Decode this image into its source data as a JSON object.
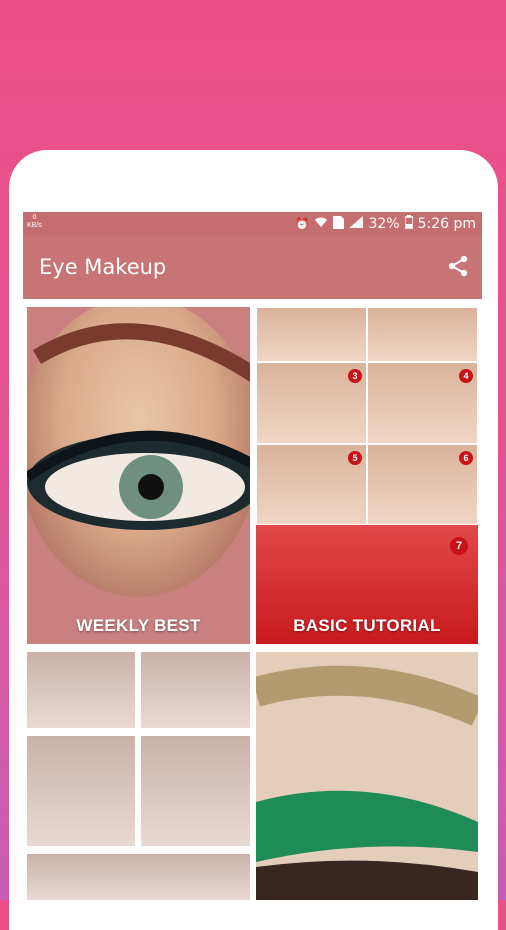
{
  "statusbar": {
    "speed_value": "0",
    "speed_unit": "KB/s",
    "battery": "32%",
    "time": "5:26 pm"
  },
  "toolbar": {
    "title": "Eye Makeup",
    "share_icon": "share-icon"
  },
  "tiles": [
    {
      "label": "WEEKLY BEST"
    },
    {
      "label": "BASIC TUTORIAL"
    }
  ],
  "tutorial_steps": [
    "3",
    "4",
    "5",
    "6",
    "7"
  ],
  "colors": {
    "background_top": "#ec4f86",
    "background_bottom": "#c85cb2",
    "toolbar": "#c77474",
    "badge": "#c8121a"
  }
}
